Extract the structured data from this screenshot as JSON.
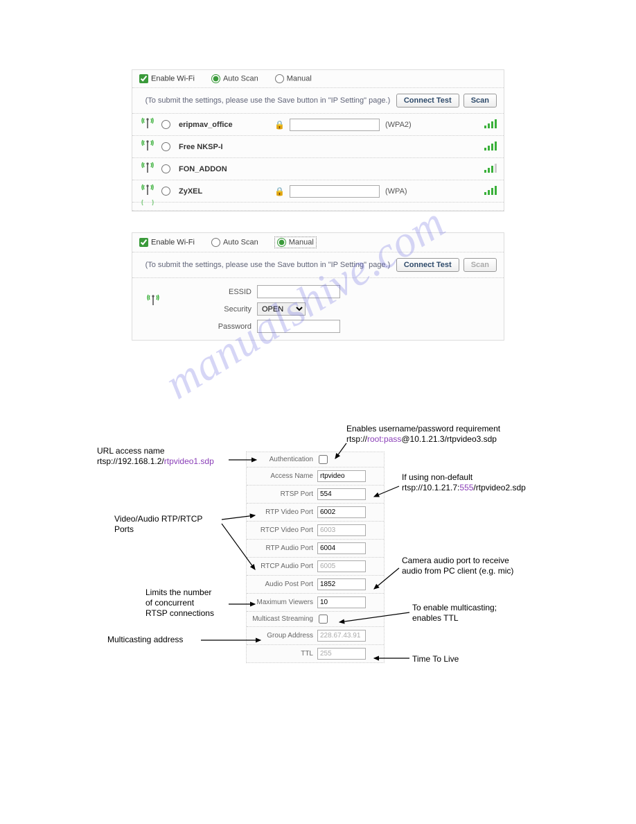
{
  "watermark": "manualshive.com",
  "wifi_panel1": {
    "enable_label": "Enable Wi-Fi",
    "auto_scan_label": "Auto Scan",
    "manual_label": "Manual",
    "mode": "auto",
    "hint": "(To submit the settings, please use the Save button in \"IP Setting\" page.)",
    "btn_connect": "Connect Test",
    "btn_scan": "Scan",
    "networks": [
      {
        "ssid": "eripmav_office",
        "locked": true,
        "enc": "(WPA2)",
        "bars": 4
      },
      {
        "ssid": "Free NKSP-I",
        "locked": false,
        "enc": "",
        "bars": 4
      },
      {
        "ssid": "FON_ADDON",
        "locked": false,
        "enc": "",
        "bars": 3
      },
      {
        "ssid": "ZyXEL",
        "locked": true,
        "enc": "(WPA)",
        "bars": 4
      }
    ]
  },
  "wifi_panel2": {
    "enable_label": "Enable Wi-Fi",
    "auto_scan_label": "Auto Scan",
    "manual_label": "Manual",
    "mode": "manual",
    "hint": "(To submit the settings, please use the Save button in \"IP Setting\" page.)",
    "btn_connect": "Connect Test",
    "btn_scan": "Scan",
    "form": {
      "essid_label": "ESSID",
      "essid_value": "",
      "security_label": "Security",
      "security_value": "OPEN",
      "password_label": "Password",
      "password_value": ""
    }
  },
  "rtsp": {
    "rows": {
      "auth_label": "Authentication",
      "auth_checked": false,
      "access_name_label": "Access Name",
      "access_name_value": "rtpvideo",
      "rtsp_port_label": "RTSP Port",
      "rtsp_port_value": "554",
      "rtp_video_label": "RTP Video Port",
      "rtp_video_value": "6002",
      "rtcp_video_label": "RTCP Video Port",
      "rtcp_video_value": "6003",
      "rtp_audio_label": "RTP Audio Port",
      "rtp_audio_value": "6004",
      "rtcp_audio_label": "RTCP Audio Port",
      "rtcp_audio_value": "6005",
      "audio_post_label": "Audio Post Port",
      "audio_post_value": "1852",
      "max_viewers_label": "Maximum Viewers",
      "max_viewers_value": "10",
      "multicast_label": "Multicast Streaming",
      "multicast_checked": false,
      "group_addr_label": "Group Address",
      "group_addr_value": "228.67.43.91",
      "ttl_label": "TTL",
      "ttl_value": "255"
    }
  },
  "annotations": {
    "url_access_1": "URL access name",
    "url_access_2a": "rtsp://192.168.1.2/",
    "url_access_2b": "rtpvideo1.sdp",
    "enable_up_1": "Enables username/password requirement",
    "enable_up_2a": "rtsp://",
    "enable_up_2b": "root:pass",
    "enable_up_2c": "@10.1.21.3/rtpvideo3.sdp",
    "ports_1": "Video/Audio RTP/RTCP",
    "ports_2": "Ports",
    "non_default_1": "If using non-default",
    "non_default_2a": "rtsp://10.1.21.7:",
    "non_default_2b": "555",
    "non_default_2c": "/rtpvideo2.sdp",
    "audio_port_1": "Camera audio port to receive",
    "audio_port_2": "audio from PC client (e.g. mic)",
    "limits_1": "Limits the number",
    "limits_2": "of concurrent",
    "limits_3": "RTSP connections",
    "multicast_1": "To enable multicasting;",
    "multicast_2": "enables TTL",
    "maddr": "Multicasting address",
    "ttl": "Time To Live"
  }
}
